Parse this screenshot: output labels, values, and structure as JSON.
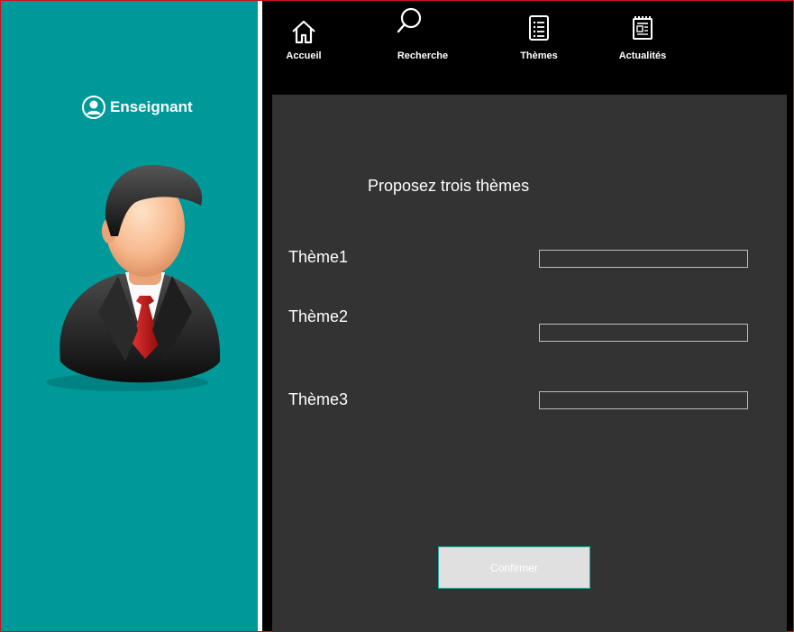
{
  "sidebar": {
    "user_label": "Enseignant"
  },
  "nav": {
    "items": [
      {
        "label": "Accueil",
        "icon": "home-icon"
      },
      {
        "label": "Recherche",
        "icon": "search-icon"
      },
      {
        "label": "Thèmes",
        "icon": "list-document-icon"
      },
      {
        "label": "Actualités",
        "icon": "newspaper-icon"
      }
    ]
  },
  "form": {
    "heading": "Proposez trois thèmes",
    "fields": [
      {
        "label": "Thème1",
        "value": ""
      },
      {
        "label": "Thème2",
        "value": ""
      },
      {
        "label": "Thème3",
        "value": ""
      }
    ],
    "confirm_label": "Confirmer"
  },
  "colors": {
    "sidebar": "#009999",
    "panel": "#333333",
    "topbar": "#000000",
    "button": "#e0e0e0",
    "frame": "#c8141e"
  }
}
